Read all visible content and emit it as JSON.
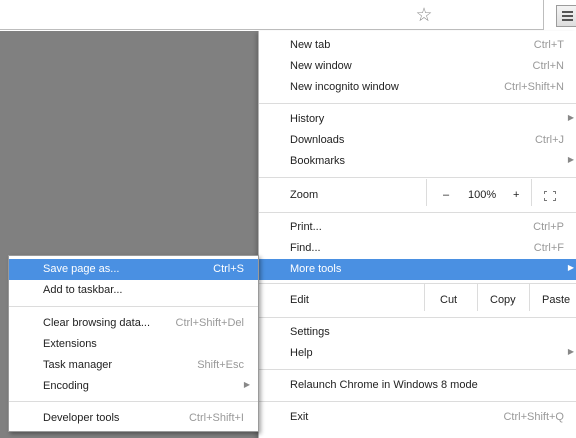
{
  "toolbar": {
    "star_icon": "star-outline-icon",
    "menu_icon": "hamburger-menu-icon"
  },
  "main_menu": {
    "group1": [
      {
        "label": "New tab",
        "shortcut": "Ctrl+T"
      },
      {
        "label": "New window",
        "shortcut": "Ctrl+N"
      },
      {
        "label": "New incognito window",
        "shortcut": "Ctrl+Shift+N"
      }
    ],
    "group2": [
      {
        "label": "History",
        "shortcut": ""
      },
      {
        "label": "Downloads",
        "shortcut": "Ctrl+J"
      },
      {
        "label": "Bookmarks",
        "shortcut": ""
      }
    ],
    "zoom": {
      "label": "Zoom",
      "minus": "–",
      "value": "100%",
      "plus": "+"
    },
    "group3": [
      {
        "label": "Print...",
        "shortcut": "Ctrl+P"
      },
      {
        "label": "Find...",
        "shortcut": "Ctrl+F"
      },
      {
        "label": "More tools",
        "shortcut": ""
      }
    ],
    "edit": {
      "label": "Edit",
      "cut": "Cut",
      "copy": "Copy",
      "paste": "Paste"
    },
    "group4": [
      {
        "label": "Settings",
        "shortcut": ""
      },
      {
        "label": "Help",
        "shortcut": ""
      }
    ],
    "relaunch": {
      "label": "Relaunch Chrome in Windows 8 mode"
    },
    "exit": {
      "label": "Exit",
      "shortcut": "Ctrl+Shift+Q"
    }
  },
  "sub_menu": {
    "group1": [
      {
        "label": "Save page as...",
        "shortcut": "Ctrl+S"
      },
      {
        "label": "Add to taskbar...",
        "shortcut": ""
      }
    ],
    "group2": [
      {
        "label": "Clear browsing data...",
        "shortcut": "Ctrl+Shift+Del"
      },
      {
        "label": "Extensions",
        "shortcut": ""
      },
      {
        "label": "Task manager",
        "shortcut": "Shift+Esc"
      },
      {
        "label": "Encoding",
        "shortcut": ""
      }
    ],
    "group3": [
      {
        "label": "Developer tools",
        "shortcut": "Ctrl+Shift+I"
      }
    ]
  },
  "colors": {
    "highlight": "#4a90e2",
    "page_bg": "#808080"
  }
}
